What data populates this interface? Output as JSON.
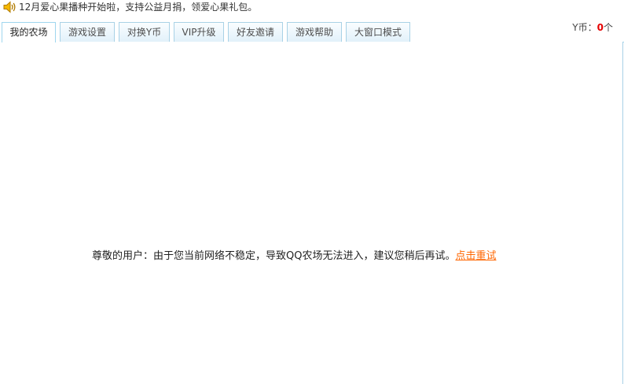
{
  "notice": {
    "icon": "speaker-icon",
    "text": "12月爱心果播种开始啦，支持公益月捐，领爱心果礼包。"
  },
  "tabs": [
    {
      "label": "我的农场",
      "active": true
    },
    {
      "label": "游戏设置",
      "active": false
    },
    {
      "label": "对换Y币",
      "active": false
    },
    {
      "label": "VIP升级",
      "active": false
    },
    {
      "label": "好友邀请",
      "active": false
    },
    {
      "label": "游戏帮助",
      "active": false
    },
    {
      "label": "大窗口模式",
      "active": false
    }
  ],
  "currency": {
    "label": "Y币：",
    "count": "0",
    "unit": "个"
  },
  "error": {
    "message": "尊敬的用户：由于您当前网络不稳定，导致QQ农场无法进入，建议您稍后再试。",
    "retry_label": "点击重试"
  },
  "colors": {
    "tab_border": "#a9d2e6",
    "retry_link": "#ff6600",
    "currency_count": "#e60000"
  }
}
